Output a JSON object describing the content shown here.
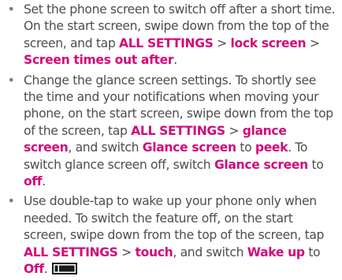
{
  "tips": [
    {
      "bullet": "•",
      "text": [
        "Set the phone screen to switch off after a short time. On the start screen, swipe down from the top of the screen, and tap ",
        "ALL SETTINGS",
        " > ",
        "lock screen",
        " > ",
        "Screen times out after",
        "."
      ]
    },
    {
      "bullet": "•",
      "text": [
        "Change the glance screen settings. To shortly see the time and your notifications when moving your phone, on the start screen, swipe down from the top of the screen, tap ",
        "ALL SETTINGS",
        " > ",
        "glance screen",
        ", and switch ",
        "Glance screen",
        " to ",
        "peek",
        ". To switch glance screen off, switch ",
        "Glance screen",
        " to ",
        "off",
        "."
      ]
    },
    {
      "bullet": "•",
      "text": [
        "Use double-tap to wake up your phone only when needed. To switch the feature off, on the start screen, swipe down from the top of the screen, tap ",
        "ALL SETTINGS",
        " > ",
        "touch",
        ", and switch ",
        "Wake up",
        " to ",
        "Off",
        "."
      ],
      "icon": "toggle-off-icon"
    }
  ],
  "colors": {
    "text": "#4d4d4d",
    "bullet": "#7a7a7a",
    "highlight": "#d20a7a",
    "icon": "#1a1a1a"
  }
}
